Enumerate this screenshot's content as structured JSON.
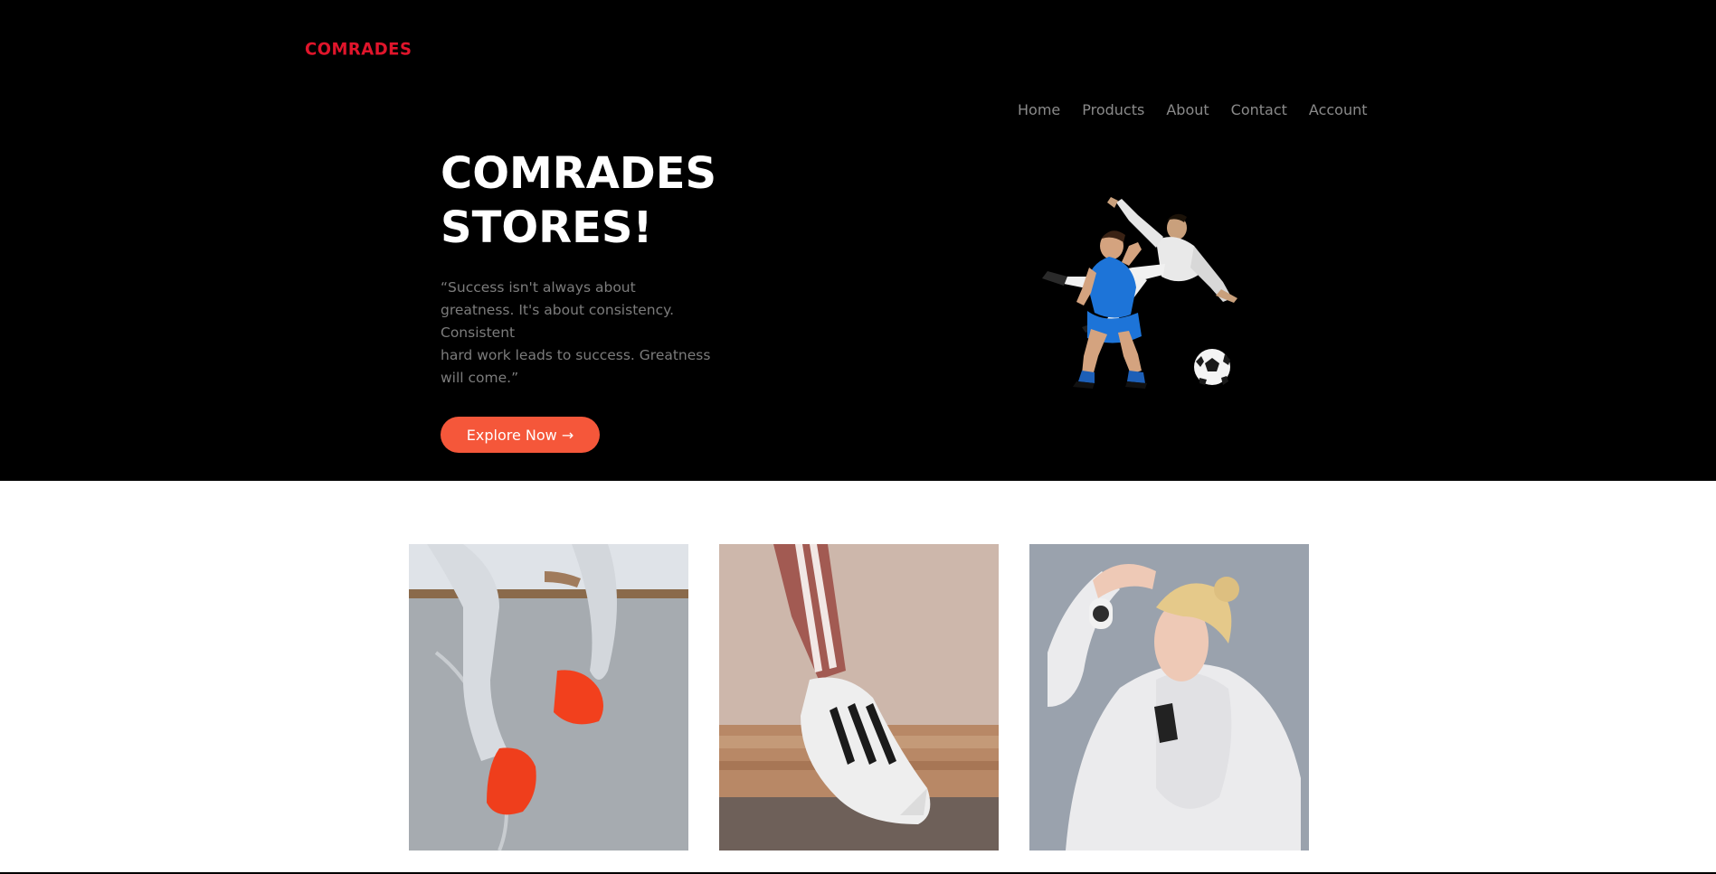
{
  "brand": {
    "logo_text": "COMRADES",
    "logo_color": "#e0152b"
  },
  "nav": {
    "items": [
      {
        "label": "Home"
      },
      {
        "label": "Products"
      },
      {
        "label": "About"
      },
      {
        "label": "Contact"
      },
      {
        "label": "Account"
      }
    ]
  },
  "hero": {
    "title": "COMRADES STORES!",
    "quote": "“Success isn't always about greatness. It's about consistency. Consistent\nhard work leads to success. Greatness will come.”",
    "cta_label": "Explore Now →",
    "cta_color": "#f5573a",
    "background_color": "#000000",
    "image_icon": "football-players-illustration"
  },
  "gallery": {
    "items": [
      {
        "icon": "orange-sneakers-photo"
      },
      {
        "icon": "white-striped-sneaker-photo"
      },
      {
        "icon": "woman-white-hoodie-photo"
      }
    ]
  }
}
